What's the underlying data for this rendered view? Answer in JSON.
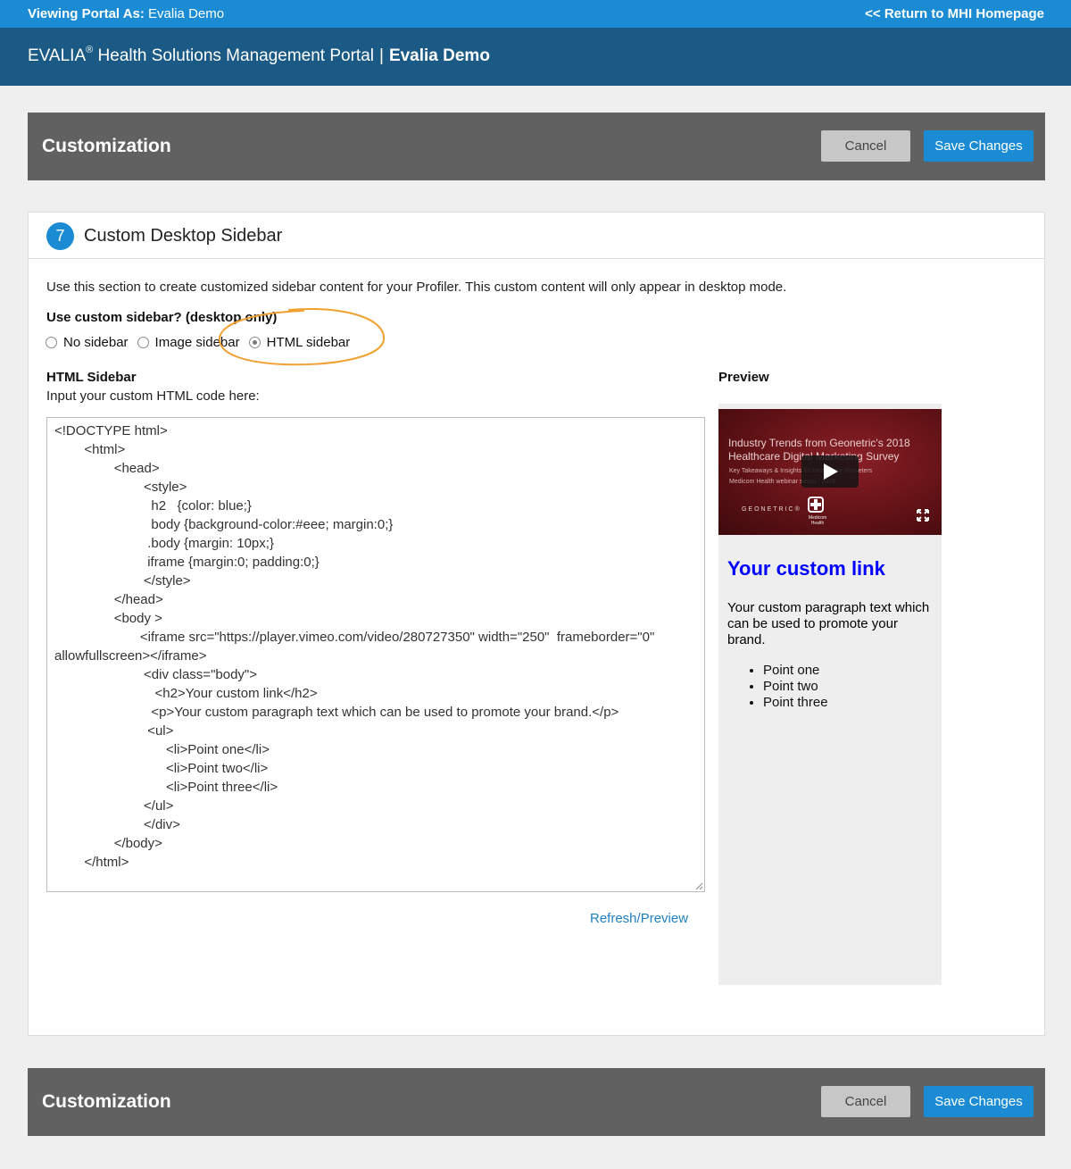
{
  "topbar": {
    "viewing_label": "Viewing Portal As:",
    "viewing_name": "Evalia Demo",
    "return_link": "<< Return to MHI Homepage"
  },
  "header": {
    "brand": "EVALIA",
    "reg_mark": "®",
    "portal_name": "Health Solutions Management Portal",
    "separator": "|",
    "client": "Evalia Demo"
  },
  "customization_bar": {
    "title": "Customization",
    "cancel_label": "Cancel",
    "save_label": "Save Changes"
  },
  "section": {
    "number": "7",
    "title": "Custom Desktop Sidebar",
    "description": "Use this section to create customized sidebar content for your Profiler. This custom content will only appear in desktop mode.",
    "question": "Use custom sidebar? (desktop only)",
    "options": [
      {
        "label": "No sidebar",
        "checked": false
      },
      {
        "label": "Image sidebar",
        "checked": false
      },
      {
        "label": "HTML sidebar",
        "checked": true
      }
    ],
    "annotation_color": "#f0a030",
    "html_label": "HTML Sidebar",
    "html_sub": "Input your custom HTML code here:",
    "code": "<!DOCTYPE html>\n        <html>\n                <head>\n                        <style>\n                          h2   {color: blue;}\n                          body {background-color:#eee; margin:0;}\n                         .body {margin: 10px;}\n                         iframe {margin:0; padding:0;}\n                        </style>\n                </head>\n                <body >\n                       <iframe src=\"https://player.vimeo.com/video/280727350\" width=\"250\"  frameborder=\"0\" allowfullscreen></iframe>\n                        <div class=\"body\">\n                           <h2>Your custom link</h2>\n                          <p>Your custom paragraph text which can be used to promote your brand.</p>\n                         <ul>\n                              <li>Point one</li>\n                              <li>Point two</li>\n                              <li>Point three</li>\n                        </ul>\n                        </div>\n                </body>\n        </html>",
    "refresh_label": "Refresh/Preview",
    "preview_label": "Preview"
  },
  "preview": {
    "video": {
      "line1": "Industry Trends from Geonetric's 2018",
      "line2": "Healthcare Digital Marketing Survey",
      "small1": "Key Takeaways & Insights for Healthcare Marketers",
      "small2": "Medicom Health webinar series | 2018",
      "logo": "GEONETRIC®",
      "partner": "Medicom Health"
    },
    "heading": "Your custom link",
    "paragraph": "Your custom paragraph text which can be used to promote your brand.",
    "points": [
      "Point one",
      "Point two",
      "Point three"
    ]
  }
}
